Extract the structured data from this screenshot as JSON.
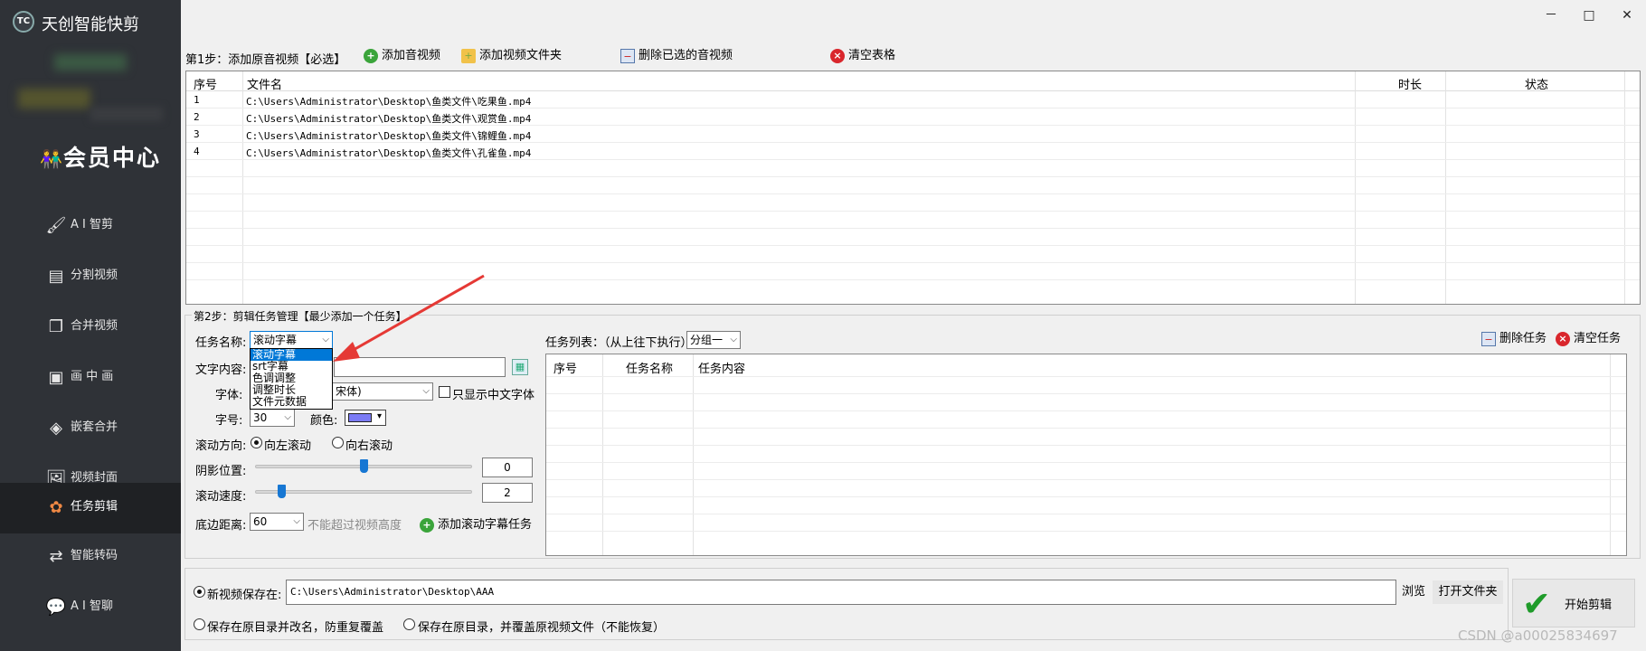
{
  "app": {
    "title": "天创智能快剪",
    "logo_text": "TC"
  },
  "sidebar": {
    "vip_label": "会员中心",
    "items": [
      {
        "label": "A I 智剪"
      },
      {
        "label": "分割视频"
      },
      {
        "label": "合并视频"
      },
      {
        "label": "画 中 画"
      },
      {
        "label": "嵌套合并"
      },
      {
        "label": "视频封面"
      },
      {
        "label": "任务剪辑"
      },
      {
        "label": "智能转码"
      },
      {
        "label": "A I 智聊"
      }
    ],
    "active": "任务剪辑"
  },
  "window": {
    "minimize": "－",
    "maximize": "□",
    "close": "✕"
  },
  "step1": {
    "label": "第1步：添加原音视频【必选】",
    "btn_add_av": "添加音视频",
    "btn_add_folder": "添加视频文件夹",
    "btn_delete_selected": "删除已选的音视频",
    "btn_clear_table": "清空表格",
    "columns": {
      "index": "序号",
      "file": "文件名",
      "duration": "时长",
      "status": "状态"
    },
    "rows": [
      {
        "index": "1",
        "file": "C:\\Users\\Administrator\\Desktop\\鱼类文件\\吃果鱼.mp4",
        "duration": "",
        "status": ""
      },
      {
        "index": "2",
        "file": "C:\\Users\\Administrator\\Desktop\\鱼类文件\\观赏鱼.mp4",
        "duration": "",
        "status": ""
      },
      {
        "index": "3",
        "file": "C:\\Users\\Administrator\\Desktop\\鱼类文件\\锦鲤鱼.mp4",
        "duration": "",
        "status": ""
      },
      {
        "index": "4",
        "file": "C:\\Users\\Administrator\\Desktop\\鱼类文件\\孔雀鱼.mp4",
        "duration": "",
        "status": ""
      }
    ]
  },
  "step2": {
    "label": "第2步：剪辑任务管理【最少添加一个任务】",
    "task_name_label": "任务名称:",
    "task_name_value": "滚动字幕",
    "dropdown_options": [
      "滚动字幕",
      "srt字幕",
      "色调调整",
      "调整时长",
      "文件元数据"
    ],
    "text_content_label": "文字内容:",
    "text_content_value": "",
    "font_label": "字体:",
    "font_value": "宋体)",
    "only_chinese_fonts": "只显示中文字体",
    "font_size_label": "字号:",
    "font_size_value": "30",
    "color_label": "颜色:",
    "scroll_dir_label": "滚动方向:",
    "scroll_left": "向左滚动",
    "scroll_right": "向右滚动",
    "shadow_label": "阴影位置:",
    "shadow_value": "0",
    "shadow_level": 0.5,
    "speed_label": "滚动速度:",
    "speed_value": "2",
    "speed_level": 0.12,
    "bottom_label": "底边距离:",
    "bottom_value": "60",
    "bottom_hint": "不能超过视频高度",
    "add_task_btn": "添加滚动字幕任务",
    "task_list_label": "任务列表：（从上往下执行）",
    "group_value": "分组一",
    "delete_task": "删除任务",
    "clear_tasks": "清空任务",
    "task_columns": {
      "index": "序号",
      "name": "任务名称",
      "content": "任务内容"
    }
  },
  "output": {
    "new_save_label": "新视频保存在:",
    "save_path": "C:\\Users\\Administrator\\Desktop\\AAA",
    "browse": "浏览",
    "open_folder": "打开文件夹",
    "option_rename": "保存在原目录并改名，防重复覆盖",
    "option_overwrite": "保存在原目录，并覆盖原视频文件（不能恢复）",
    "start_btn": "开始剪辑"
  },
  "watermark": "CSDN @a00025834697",
  "colors": {
    "sidebar_bg": "#2f3237",
    "active_bg": "#1f2124",
    "accent": "#0078d7",
    "swatch": "#7b7bf5"
  }
}
